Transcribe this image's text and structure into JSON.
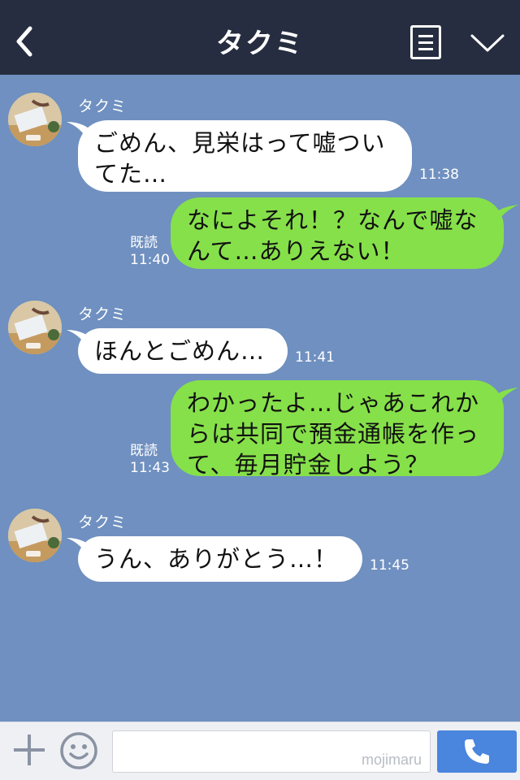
{
  "header": {
    "title": "タクミ"
  },
  "messages": [
    {
      "sender": "タクミ",
      "text": "ごめん、見栄はって嘘ついてた…",
      "time": "11:38",
      "direction": "in"
    },
    {
      "text": "なによそれ！？なんで嘘なんて…ありえない！",
      "time": "11:40",
      "read": "既読",
      "direction": "out"
    },
    {
      "sender": "タクミ",
      "text": "ほんとごめん…",
      "time": "11:41",
      "direction": "in"
    },
    {
      "text": "わかったよ…じゃあこれからは共同で預金通帳を作って、毎月貯金しよう？",
      "time": "11:43",
      "read": "既読",
      "direction": "out"
    },
    {
      "sender": "タクミ",
      "text": "うん、ありがとう…！",
      "time": "11:45",
      "direction": "in"
    }
  ],
  "input": {
    "watermark": "mojimaru"
  },
  "icons": {
    "back": "back-chevron-icon",
    "menu": "menu-list-icon",
    "expand": "chevron-down-icon",
    "add": "plus-icon",
    "emoji": "smiley-icon",
    "call": "phone-icon"
  },
  "colors": {
    "header_bg": "#262d40",
    "chat_bg": "#6f90c0",
    "incoming_bubble": "#ffffff",
    "outgoing_bubble": "#86e04a",
    "call_button": "#4a85de"
  }
}
